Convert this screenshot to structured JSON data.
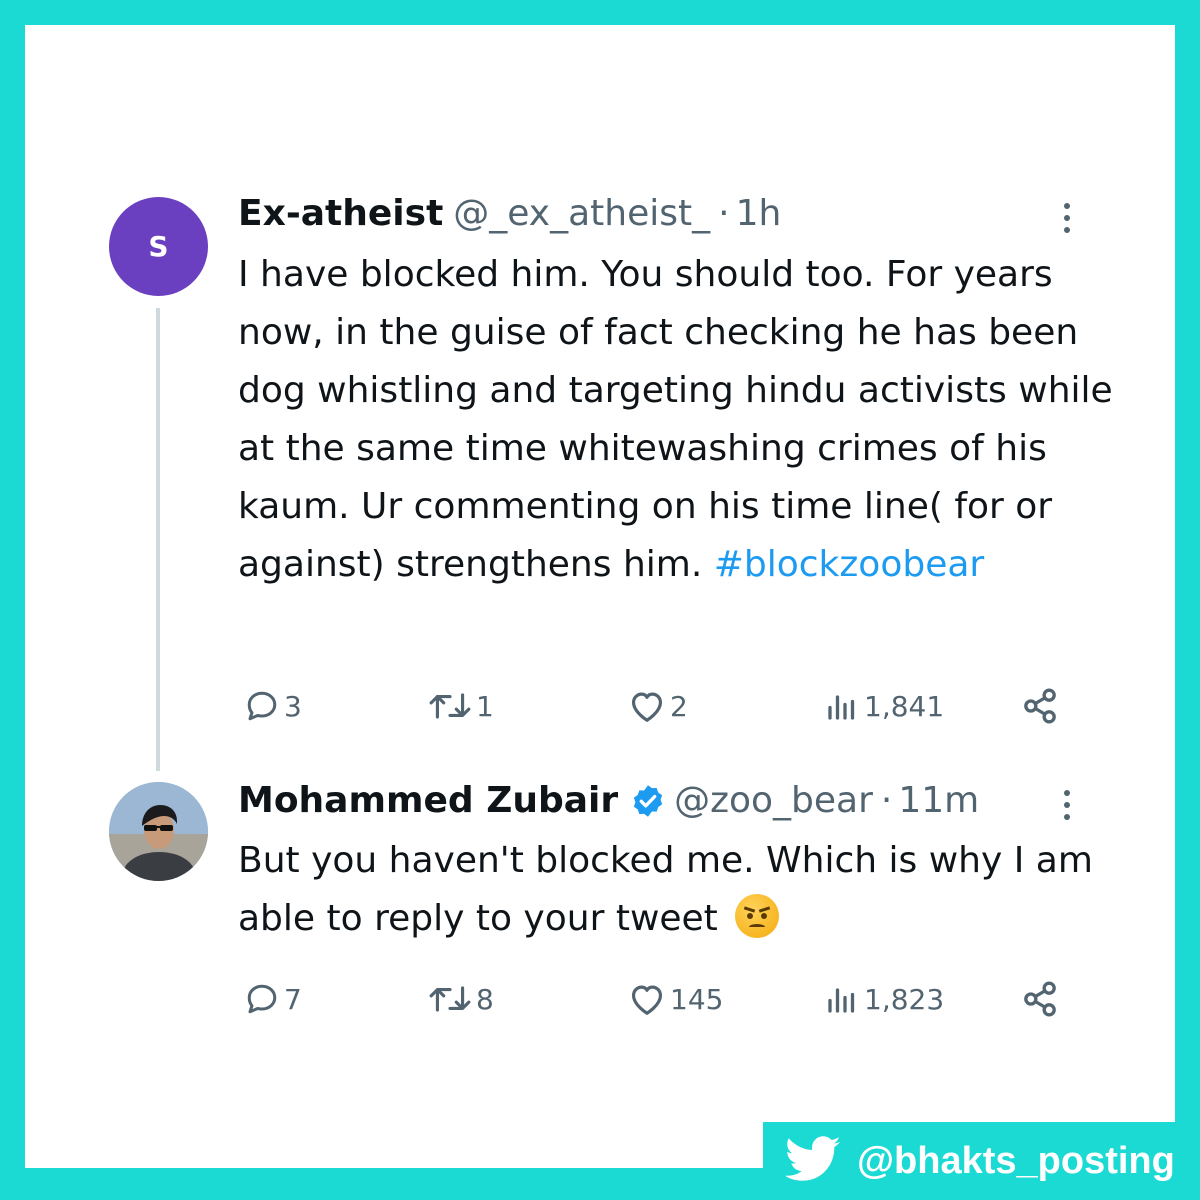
{
  "tweet1": {
    "avatar_letter": "S",
    "display_name": "Ex-atheist",
    "handle": "@_ex_atheist_",
    "separator": "·",
    "time": "1h",
    "text": "I have blocked him. You should too.  For years now, in the guise of fact checking he has been dog whistling and targeting hindu activists while at the same time whitewashing crimes of his kaum.  Ur commenting on his time line( for or against) strengthens him.  ",
    "hashtag": "#blockzoobear",
    "replies": "3",
    "retweets": "1",
    "likes": "2",
    "views": "1,841"
  },
  "tweet2": {
    "display_name": "Mohammed Zubair",
    "verified": true,
    "handle": "@zoo_bear",
    "separator": "·",
    "time": "11m",
    "text": "But you haven't blocked me. Which is why I am able to reply to your tweet",
    "emoji": "angry-face",
    "replies": "7",
    "retweets": "8",
    "likes": "145",
    "views": "1,823"
  },
  "watermark": {
    "icon": "twitter-bird-icon",
    "handle": "@bhakts_posting"
  },
  "colors": {
    "frame": "#1bd9d3",
    "avatar_bg": "#6a3fc0",
    "hashtag": "#1d9bf0",
    "verified": "#1d9bf0",
    "muted": "#536471"
  }
}
